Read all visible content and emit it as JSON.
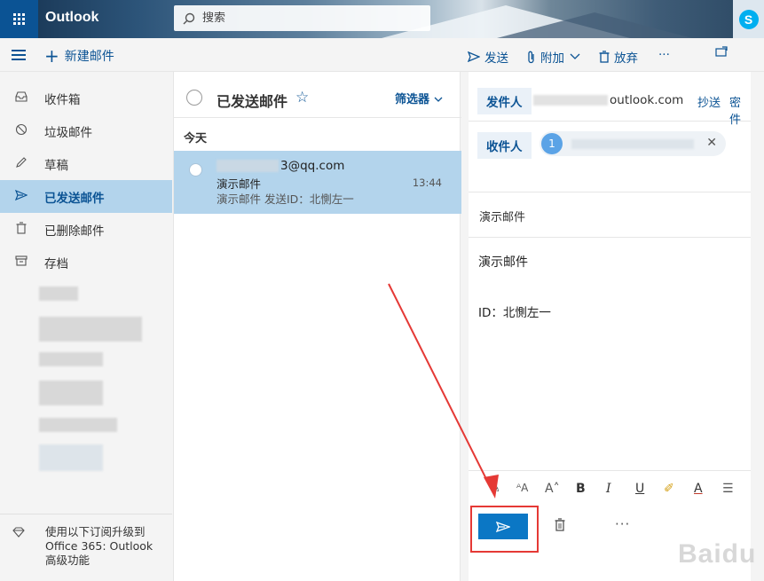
{
  "header": {
    "brand": "Outlook",
    "search_placeholder": "搜索",
    "skype_letter": "S"
  },
  "toolbar": {
    "new_mail": "新建邮件",
    "send": "发送",
    "attach": "附加",
    "discard": "放弃",
    "more": "···"
  },
  "sidebar": {
    "items": [
      {
        "label": "收件箱",
        "icon": "inbox-icon"
      },
      {
        "label": "垃圾邮件",
        "icon": "junk-icon"
      },
      {
        "label": "草稿",
        "icon": "pencil-icon"
      },
      {
        "label": "已发送邮件",
        "icon": "send-icon",
        "active": true
      },
      {
        "label": "已删除邮件",
        "icon": "trash-icon"
      },
      {
        "label": "存档",
        "icon": "archive-icon"
      }
    ],
    "upgrade_text": "使用以下订阅升级到 Office 365: Outlook 高级功能"
  },
  "message_list": {
    "title": "已发送邮件",
    "filter": "筛选器",
    "group": "今天",
    "messages": [
      {
        "from_suffix": "3@qq.com",
        "subject": "演示邮件",
        "preview": "演示邮件 发送ID：北惻左一",
        "time": "13:44"
      }
    ]
  },
  "compose": {
    "from_label": "发件人",
    "from_suffix": "outlook.com",
    "cc": "抄送",
    "bcc": "密件",
    "to_label": "收件人",
    "recipient_avatar": "1",
    "subject": "演示邮件",
    "body_line1": "演示邮件",
    "body_line2": "ID：北惻左一"
  },
  "watermark": "Baidu"
}
